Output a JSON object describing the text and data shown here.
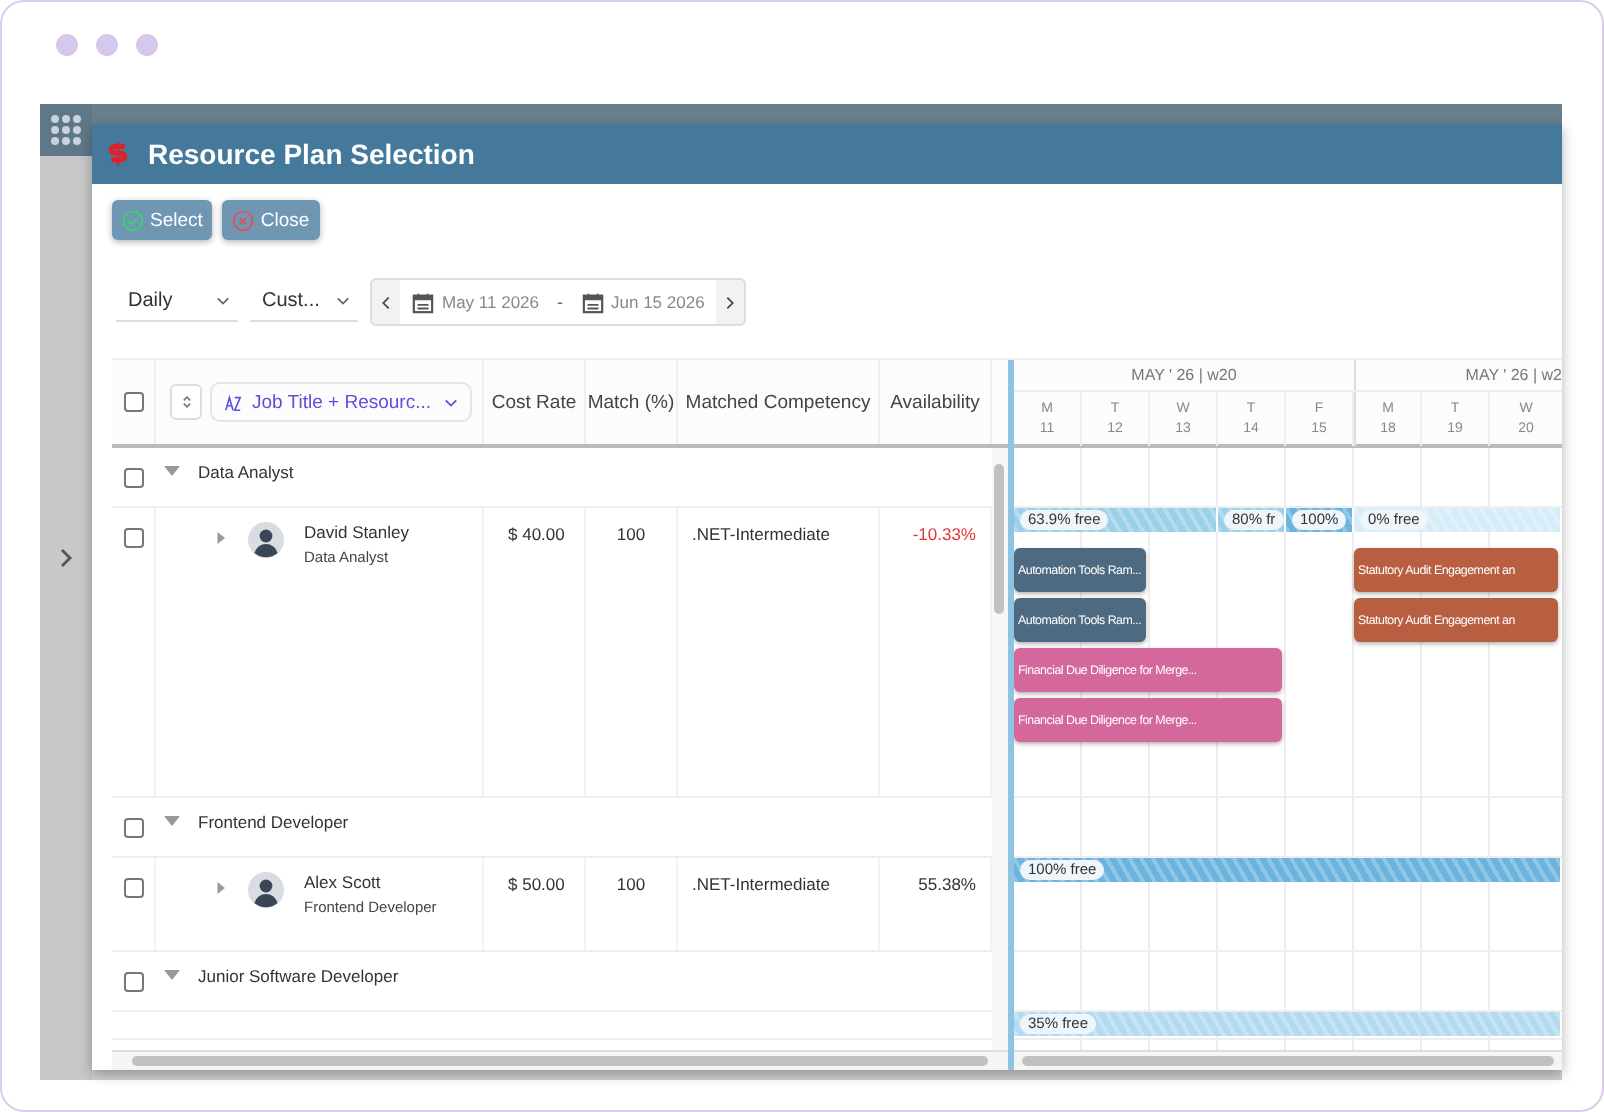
{
  "window": {
    "title": "Resource Plan Selection"
  },
  "toolbar": {
    "buttons": [
      {
        "label": "Select",
        "kind": "select"
      },
      {
        "label": "Close",
        "kind": "close"
      }
    ]
  },
  "filters": {
    "view": "Daily",
    "range_type": "Cust...",
    "start_date": "May 11 2026",
    "separator": "-",
    "end_date": "Jun 15 2026"
  },
  "table": {
    "header_checked": false,
    "group_by": "Job Title + Resourc...",
    "columns": [
      "Cost Rate",
      "Match (%)",
      "Matched Competency",
      "Availability"
    ],
    "groups": [
      {
        "title": "Data Analyst",
        "checked": false,
        "expanded": true,
        "resources": [
          {
            "name": "David Stanley",
            "role": "Data Analyst",
            "cost_rate": "$ 40.00",
            "match": "100",
            "competency": ".NET-Intermediate",
            "availability": "-10.33%",
            "negative": true,
            "checked": false,
            "expanded": false,
            "availability_bars": [
              {
                "label": "63.9% free",
                "color": "#9ccfea"
              },
              {
                "label": "80% fr",
                "color": "#9ccfea"
              },
              {
                "label": "100%",
                "color": "#6cb4de"
              },
              {
                "label": "0% free",
                "color": "#d6ecf8"
              }
            ],
            "task_lanes": [
              [
                {
                  "label": "Automation Tools Ram...",
                  "color": "#4d6a80"
                },
                {
                  "label": "Statutory Audit Engagement an",
                  "color": "#b85f42"
                }
              ],
              [
                {
                  "label": "Automation Tools Ram...",
                  "color": "#4d6a80"
                },
                {
                  "label": "Statutory Audit Engagement an",
                  "color": "#b85f42"
                }
              ],
              [
                {
                  "label": "Financial Due Diligence for Merge...",
                  "color": "#d4679b"
                }
              ],
              [
                {
                  "label": "Financial Due Diligence for Merge...",
                  "color": "#d4679b"
                }
              ]
            ]
          }
        ]
      },
      {
        "title": "Frontend Developer",
        "checked": false,
        "expanded": true,
        "resources": [
          {
            "name": "Alex Scott",
            "role": "Frontend Developer",
            "cost_rate": "$ 50.00",
            "match": "100",
            "competency": ".NET-Intermediate",
            "availability": "55.38%",
            "negative": false,
            "checked": false,
            "expanded": false,
            "availability_bars": [
              {
                "label": "100% free",
                "color": "#6cb4de"
              }
            ]
          }
        ]
      },
      {
        "title": "Junior Software Developer",
        "checked": false,
        "expanded": true,
        "resources": [
          {
            "availability_bars": [
              {
                "label": "35% free",
                "color": "#b3dbf0"
              }
            ]
          }
        ]
      }
    ]
  },
  "timeline": {
    "weeks": [
      {
        "label": "MAY ' 26 | w20"
      },
      {
        "label": "MAY ' 26 | w2"
      }
    ],
    "days": [
      {
        "weekday": "M",
        "day": "11"
      },
      {
        "weekday": "T",
        "day": "12"
      },
      {
        "weekday": "W",
        "day": "13"
      },
      {
        "weekday": "T",
        "day": "14"
      },
      {
        "weekday": "F",
        "day": "15"
      },
      {
        "weekday": "M",
        "day": "18"
      },
      {
        "weekday": "T",
        "day": "19"
      },
      {
        "weekday": "W",
        "day": "20"
      }
    ]
  }
}
